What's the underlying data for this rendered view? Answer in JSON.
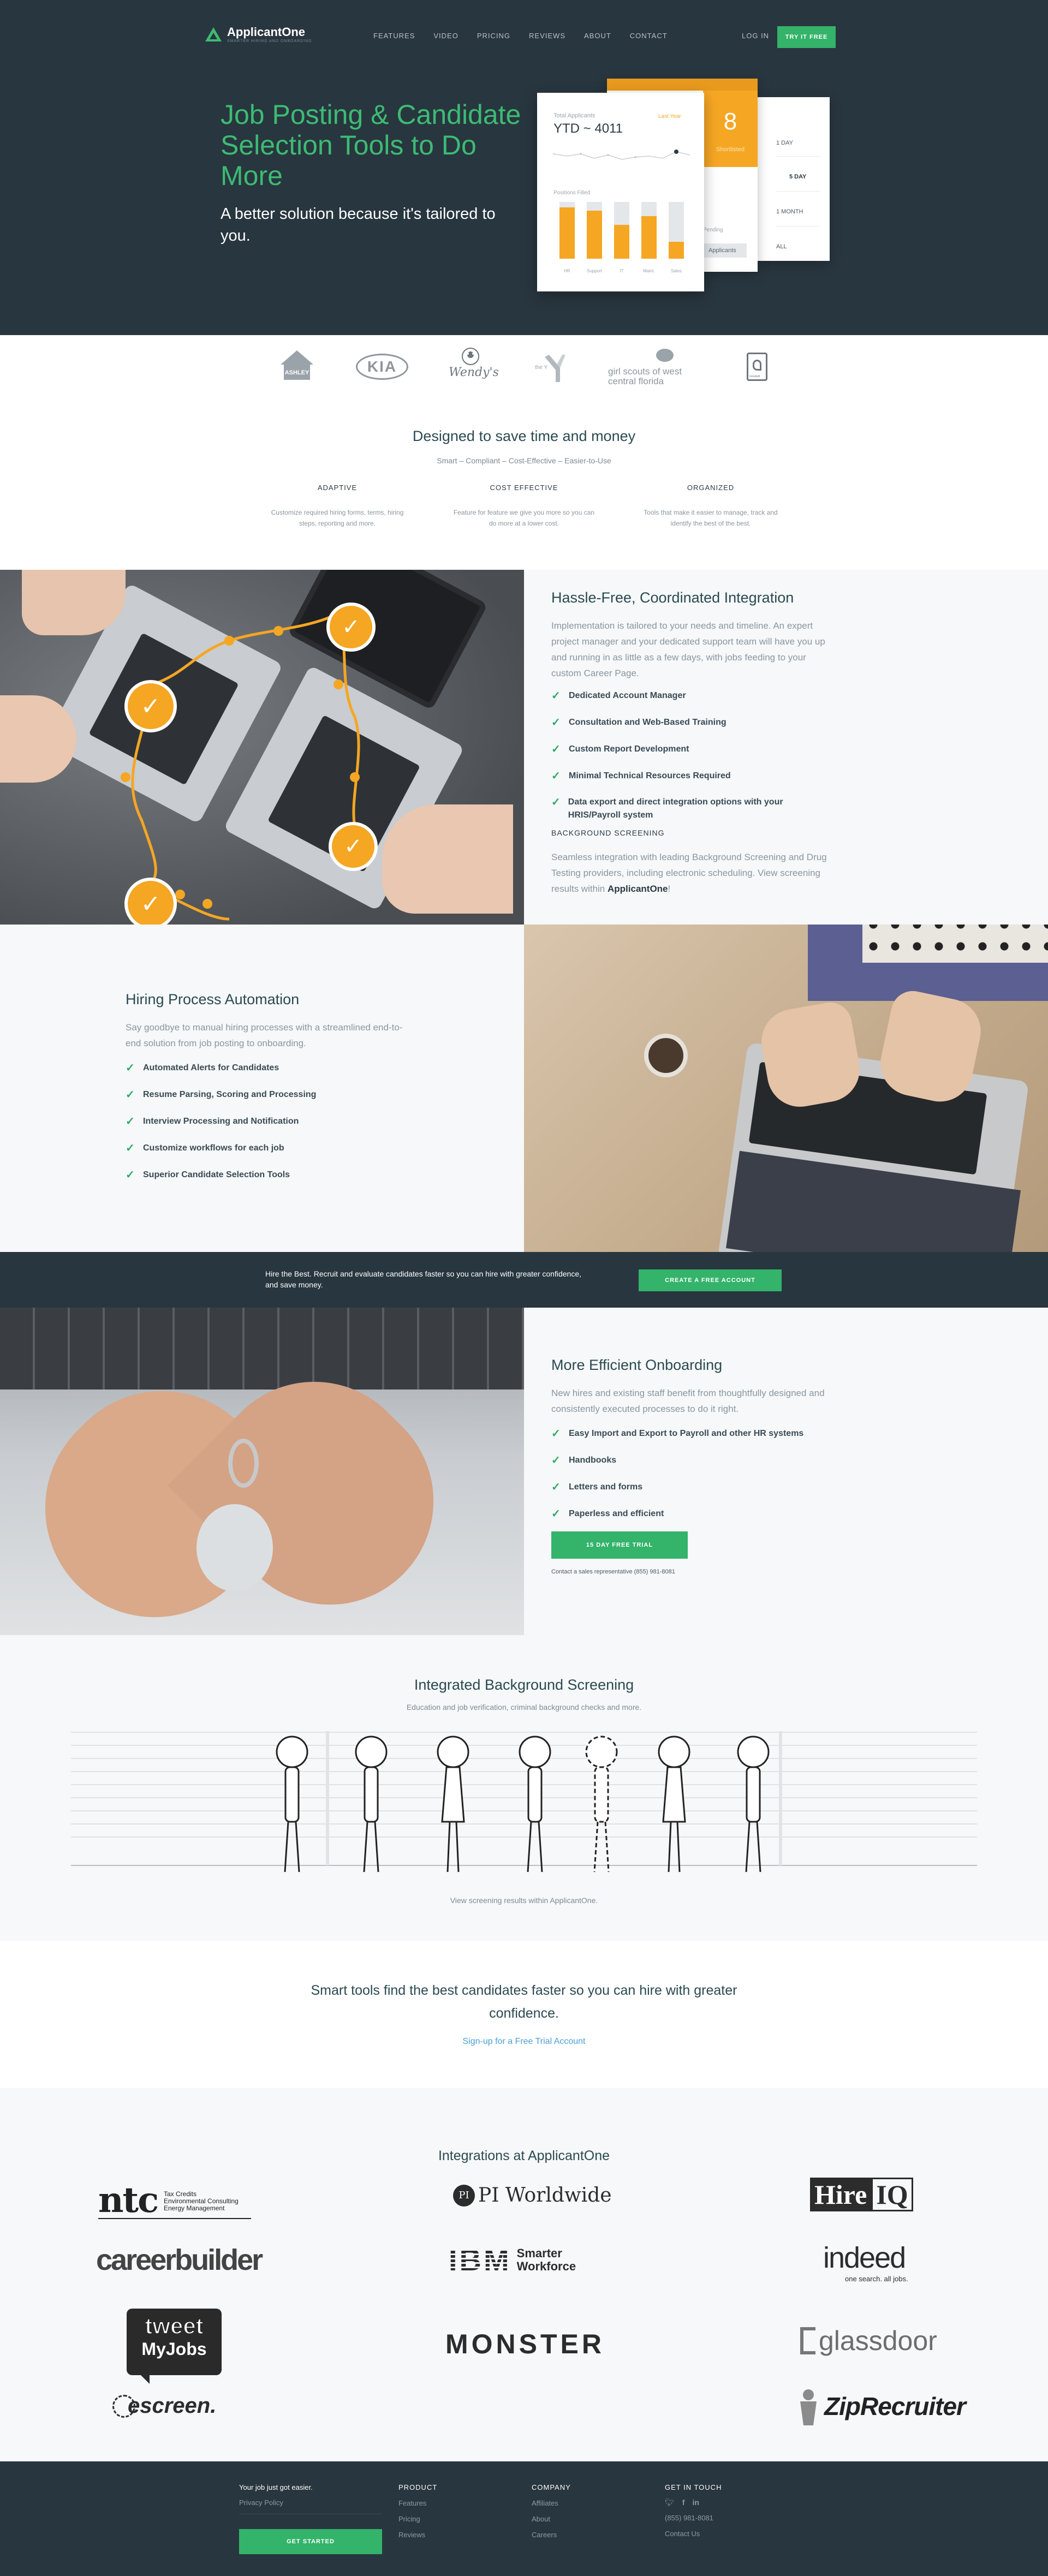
{
  "header": {
    "brand": "ApplicantOne",
    "tagline": "SMARTER HIRING AND ONBOARDING",
    "nav": [
      "FEATURES",
      "VIDEO",
      "PRICING",
      "REVIEWS",
      "ABOUT",
      "CONTACT"
    ],
    "login": "LOG IN",
    "try_free": "TRY IT FREE"
  },
  "hero": {
    "title": "Job Posting & Candidate Selection Tools to Do More",
    "subtitle": "A better solution because it's tailored to you.",
    "card_main": {
      "label": "Total Applicants",
      "value": "YTD ~ 4011",
      "link": "Last Year",
      "chart_title": "Positions Filled",
      "bars": [
        {
          "label": "HR",
          "value": 0.9
        },
        {
          "label": "Support",
          "value": 0.85
        },
        {
          "label": "IT",
          "value": 0.6
        },
        {
          "label": "Maint.",
          "value": 0.75
        },
        {
          "label": "Sales",
          "value": 0.3
        }
      ]
    },
    "card_orange": {
      "value": "8",
      "label": "Shortlisted"
    },
    "card_range": {
      "options": [
        "1 DAY",
        "5 DAY",
        "1 MONTH",
        "ALL"
      ],
      "selected": "5 DAY"
    },
    "applicants_label": "Applicants",
    "pending_label": "Pending"
  },
  "clients": [
    "ASHLEY",
    "KIA",
    "Wendy's",
    "the Y",
    "girl scouts of west central florida",
    "Goodwill"
  ],
  "save": {
    "title": "Designed to save time and money",
    "subtitle": "Smart – Compliant – Cost-Effective – Easier-to-Use",
    "cols": [
      {
        "title": "ADAPTIVE",
        "text": "Customize required hiring forms, terms, hiring steps, reporting and more."
      },
      {
        "title": "COST EFFECTIVE",
        "text": "Feature for feature we give you more so you can do more at a lower cost."
      },
      {
        "title": "ORGANIZED",
        "text": "Tools that make it easier to manage, track and identify the best of the best."
      }
    ]
  },
  "integration": {
    "title": "Hassle-Free, Coordinated Integration",
    "text": "Implementation is tailored to your needs and timeline. An expert project manager and your dedicated support team will have you up and running in as little as a few days, with jobs feeding to your custom Career Page.",
    "items": [
      "Dedicated Account Manager",
      "Consultation and Web-Based Training",
      "Custom Report Development",
      "Minimal Technical Resources Required",
      "Data export and direct integration options with your HRIS/Payroll system"
    ],
    "bg_title": "BACKGROUND SCREENING",
    "bg_text": "Seamless integration with leading Background Screening and Drug Testing providers, including electronic scheduling. View screening results within",
    "bg_brand": "ApplicantOne"
  },
  "automation": {
    "title": "Hiring Process Automation",
    "text": "Say goodbye to manual hiring processes with a streamlined end-to-end solution from job posting to onboarding.",
    "items": [
      "Automated Alerts for Candidates",
      "Resume Parsing, Scoring and Processing",
      "Interview Processing and Notification",
      "Customize workflows for each job",
      "Superior Candidate Selection Tools"
    ]
  },
  "cta_band": {
    "text": "Hire the Best. Recruit and evaluate candidates faster so you can hire with greater confidence, and save money.",
    "button": "CREATE A FREE ACCOUNT"
  },
  "onboarding": {
    "title": "More Efficient Onboarding",
    "text": "New hires and existing staff benefit from thoughtfully designed and consistently executed processes to do it right.",
    "items": [
      "Easy Import and Export to Payroll and other HR systems",
      "Handbooks",
      "Letters and forms",
      "Paperless and efficient"
    ],
    "button": "15 DAY FREE TRIAL",
    "contact": "Contact a sales representative (855) 981-8081"
  },
  "screening": {
    "title": "Integrated Background Screening",
    "subtitle": "Education and job verification, criminal background checks and more.",
    "caption": "View screening results within ApplicantOne."
  },
  "smart": {
    "title": "Smart tools find the best candidates faster so you can hire with greater confidence.",
    "link": "Sign-up for a Free Trial Account"
  },
  "integrations": {
    "title": "Integrations at ApplicantOne",
    "ntc_main": "ntc",
    "ntc_sub": [
      "Tax Credits",
      "Environmental Consulting",
      "Energy Management"
    ],
    "pi": "PI Worldwide",
    "hireiq_a": "Hire",
    "hireiq_b": "IQ",
    "careerbuilder": "careerbuilder",
    "ibm": "IBM",
    "ibm_sub": [
      "Smarter",
      "Workforce"
    ],
    "indeed": "indeed",
    "indeed_sub": "one search. all jobs.",
    "tweet_a": "tweet",
    "tweet_b": "MyJobs",
    "monster": "MONSTER",
    "glassdoor": "glassdoor",
    "escreen": "escreen.",
    "ziprecruiter": "ZipRecruiter"
  },
  "footer": {
    "tag": "Your job just got easier.",
    "privacy": "Privacy Policy",
    "get_started": "GET STARTED",
    "product_title": "PRODUCT",
    "product": [
      "Features",
      "Pricing",
      "Reviews"
    ],
    "company_title": "COMPANY",
    "company": [
      "Affiliates",
      "About",
      "Careers"
    ],
    "touch_title": "GET IN TOUCH",
    "phone": "(855) 981-8081",
    "contact": "Contact Us"
  },
  "colors": {
    "dark": "#28363f",
    "green": "#3dbb73",
    "orange": "#f5a623"
  }
}
